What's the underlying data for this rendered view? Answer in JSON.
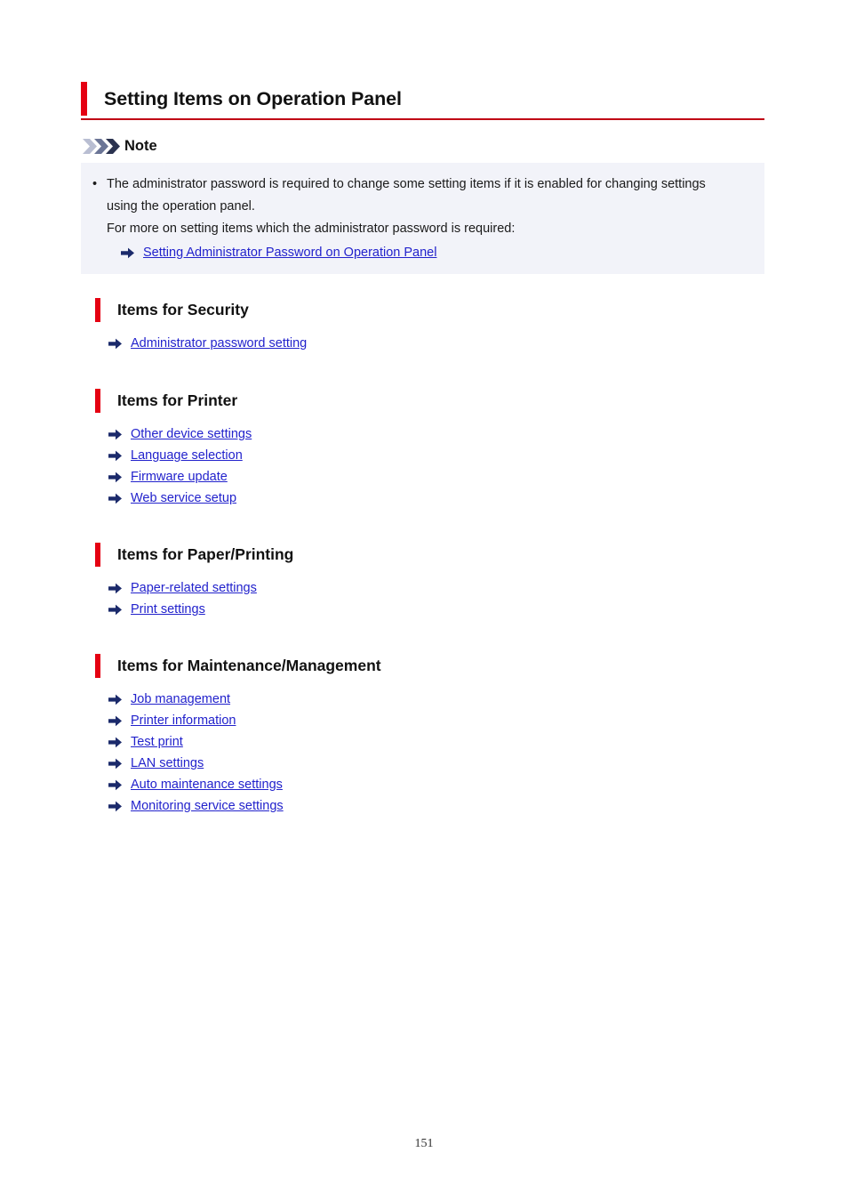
{
  "page": {
    "title": "Setting Items on Operation Panel",
    "number": "151",
    "accent_color": "#e50012",
    "link_color": "#2222cc",
    "note_background": "#f2f3f9"
  },
  "note": {
    "icon": "triple-chevron-icon",
    "label": "Note",
    "bullet_char": "•",
    "paragraph1": "The administrator password is required to change some setting items if it is enabled for changing settings using the operation panel.",
    "paragraph2": "For more on setting items which the administrator password is required:",
    "link": "Setting Administrator Password on Operation Panel"
  },
  "sections": [
    {
      "heading": "Items for Security",
      "links": [
        "Administrator password setting"
      ]
    },
    {
      "heading": "Items for Printer",
      "links": [
        "Other device settings",
        "Language selection",
        "Firmware update",
        "Web service setup"
      ]
    },
    {
      "heading": "Items for Paper/Printing",
      "links": [
        "Paper-related settings",
        "Print settings"
      ]
    },
    {
      "heading": "Items for Maintenance/Management",
      "links": [
        "Job management",
        "Printer information",
        "Test print",
        "LAN settings",
        "Auto maintenance settings",
        "Monitoring service settings"
      ]
    }
  ]
}
